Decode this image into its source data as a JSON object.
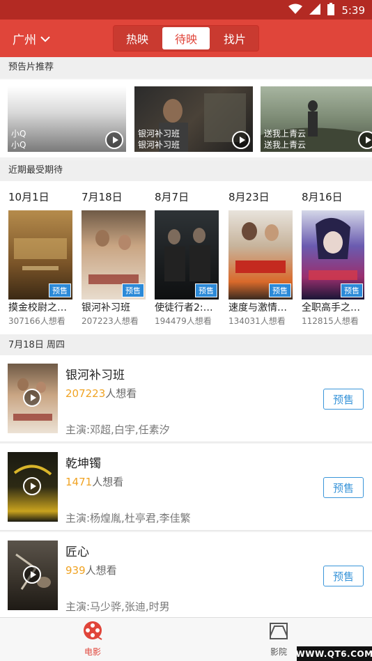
{
  "status_bar": {
    "time": "5:39",
    "icons": [
      "wifi-icon",
      "signal-icon",
      "battery-icon"
    ]
  },
  "header": {
    "city": "广州",
    "tabs": [
      {
        "label": "热映",
        "active": false
      },
      {
        "label": "待映",
        "active": true
      },
      {
        "label": "找片",
        "active": false
      }
    ]
  },
  "sections": {
    "trailers": "预告片推荐",
    "anticipated": "近期最受期待",
    "date_header": "7月18日 周四"
  },
  "trailers": [
    {
      "label": "小Q",
      "sublabel": "小Q"
    },
    {
      "label": "银河补习班",
      "sublabel": "银河补习班"
    },
    {
      "label": "送我上青云",
      "sublabel": "送我上青云"
    }
  ],
  "anticipated": [
    {
      "date": "10月1日",
      "title": "摸金校尉之…",
      "count": "307166人想看",
      "badge": "预售"
    },
    {
      "date": "7月18日",
      "title": "银河补习班",
      "count": "207223人想看",
      "badge": "预售"
    },
    {
      "date": "8月7日",
      "title": "使徒行者2:…",
      "count": "194479人想看",
      "badge": "预售"
    },
    {
      "date": "8月23日",
      "title": "速度与激情…",
      "count": "134031人想看",
      "badge": "预售"
    },
    {
      "date": "8月16日",
      "title": "全职高手之…",
      "count": "112815人想看",
      "badge": "预售"
    }
  ],
  "movies": [
    {
      "title": "银河补习班",
      "want_num": "207223",
      "want_suffix": "人想看",
      "cast": "主演:邓超,白宇,任素汐",
      "button": "预售"
    },
    {
      "title": "乾坤镯",
      "want_num": "1471",
      "want_suffix": "人想看",
      "cast": "主演:杨煌胤,杜亭君,李佳繁",
      "button": "预售"
    },
    {
      "title": "匠心",
      "want_num": "939",
      "want_suffix": "人想看",
      "cast": "主演:马少骅,张迪,时男",
      "button": "预售"
    }
  ],
  "bottom_nav": [
    {
      "label": "电影",
      "active": true,
      "icon": "film-reel-icon"
    },
    {
      "label": "影院",
      "active": false,
      "icon": "cinema-icon"
    }
  ],
  "watermark": "WWW.QT6.COM",
  "colors": {
    "accent": "#e0453a",
    "status_bar": "#b32a23",
    "blue": "#3a95d9",
    "orange": "#f0a323"
  }
}
